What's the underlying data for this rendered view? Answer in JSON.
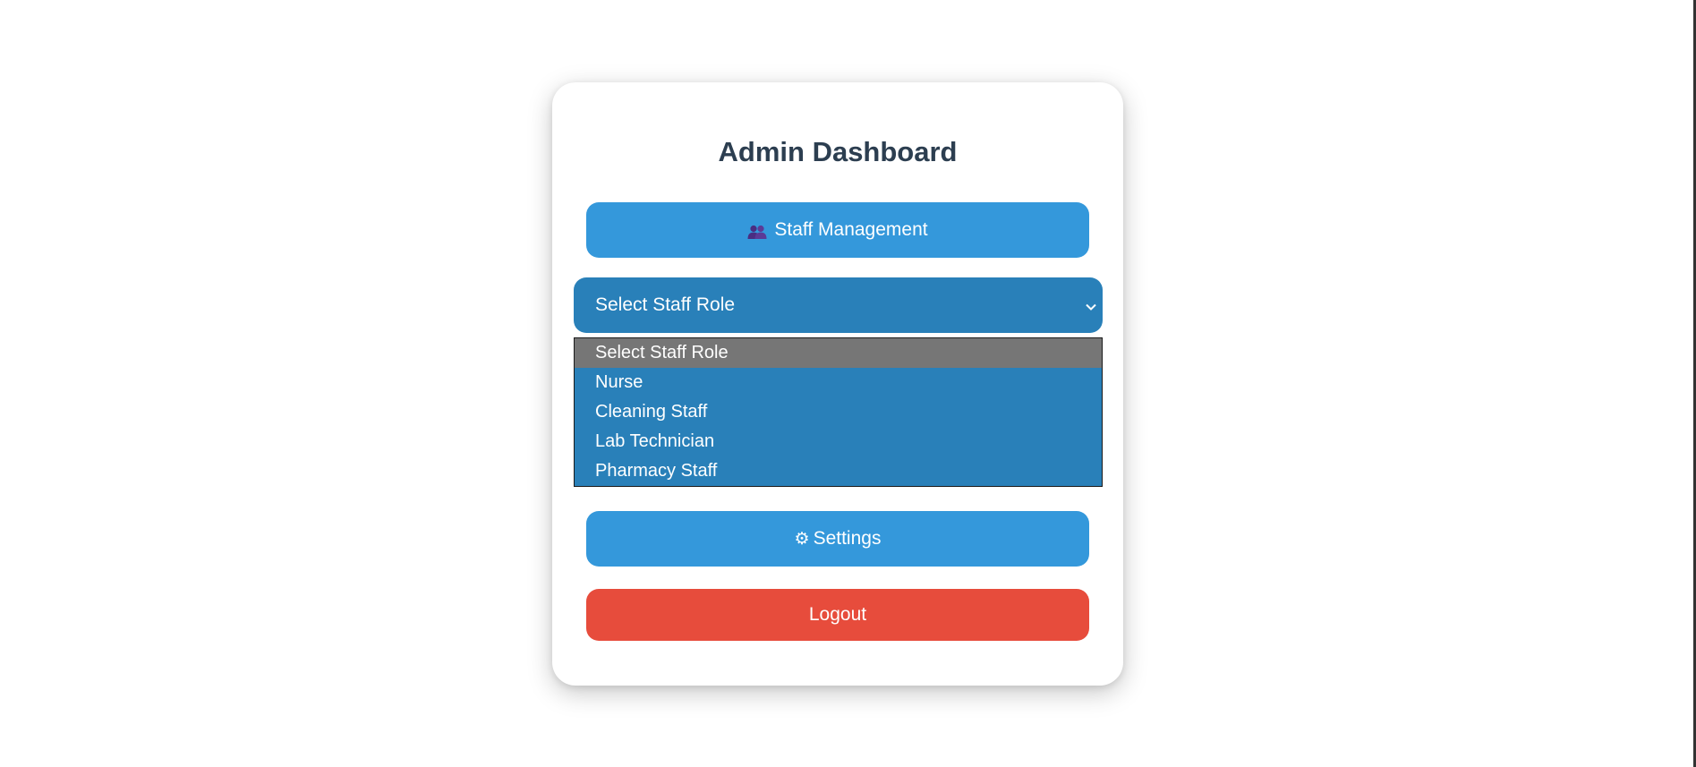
{
  "dashboard": {
    "title": "Admin Dashboard",
    "staff_button": {
      "label": "Staff Management",
      "icon": "people-icon"
    },
    "role_select": {
      "selected": "Select Staff Role",
      "options": [
        "Select Staff Role",
        "Nurse",
        "Cleaning Staff",
        "Lab Technician",
        "Pharmacy Staff"
      ]
    },
    "settings_button": {
      "label": "Settings",
      "icon": "gear-icon"
    },
    "logout_button": {
      "label": "Logout"
    }
  },
  "colors": {
    "primary": "#3498db",
    "select_bg": "#2980b9",
    "danger": "#e74c3c",
    "title": "#2c3e50",
    "option_highlight": "#767676"
  }
}
